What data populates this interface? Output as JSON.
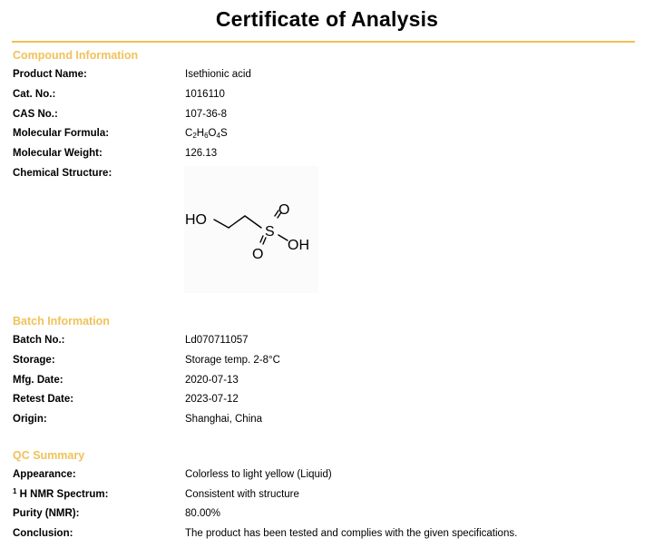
{
  "title": "Certificate of Analysis",
  "compound": {
    "heading": "Compound Information",
    "product_name_label": "Product Name:",
    "product_name": "Isethionic acid",
    "cat_label": "Cat. No.:",
    "cat": "1016110",
    "cas_label": "CAS No.:",
    "cas": "107-36-8",
    "formula_label": "Molecular Formula:",
    "formula": {
      "c": "C",
      "c_n": "2",
      "h": "H",
      "h_n": "6",
      "o": "O",
      "o_n": "4",
      "s": "S"
    },
    "weight_label": "Molecular Weight:",
    "weight": "126.13",
    "structure_label": "Chemical Structure:",
    "structure_atoms": {
      "ho": "HO",
      "s": "S",
      "o_top": "O",
      "o_bottom": "O",
      "oh": "OH"
    }
  },
  "batch": {
    "heading": "Batch Information",
    "batch_label": "Batch No.:",
    "batch": "Ld070711057",
    "storage_label": "Storage:",
    "storage": "Storage temp. 2-8°C",
    "mfg_label": "Mfg. Date:",
    "mfg": "2020-07-13",
    "retest_label": "Retest Date:",
    "retest": "2023-07-12",
    "origin_label": "Origin:",
    "origin": "Shanghai, China"
  },
  "qc": {
    "heading": "QC Summary",
    "appearance_label": "Appearance:",
    "appearance": "Colorless to light yellow (Liquid)",
    "nmr_sup": "1",
    "nmr_label": " H NMR Spectrum:",
    "nmr": "Consistent with structure",
    "purity_label": "Purity (NMR):",
    "purity": "80.00%",
    "conclusion_label": "Conclusion:",
    "conclusion": "The product has been tested and complies with the given specifications."
  }
}
